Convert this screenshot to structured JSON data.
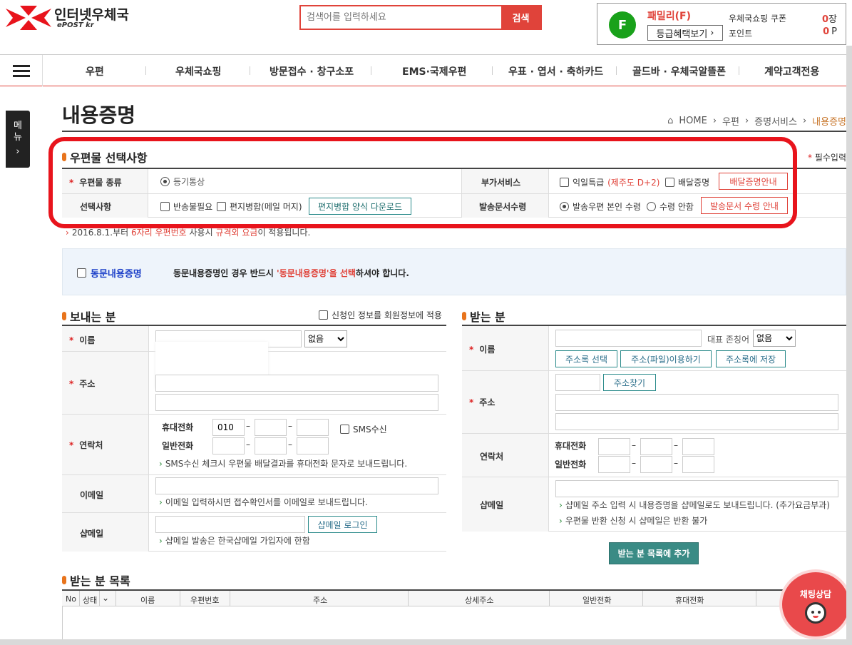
{
  "header": {
    "logo_title": "인터넷우체국",
    "logo_sub": "ePOST kr",
    "search_placeholder": "검색어를 입력하세요",
    "search_button": "검색",
    "member_initial": "F",
    "member_grade": "패밀리(F)",
    "grade_button": "등급혜택보기",
    "coupon_label": "우체국쇼핑 쿠폰",
    "coupon_value": "0",
    "coupon_unit": "장",
    "point_label": "포인트",
    "point_value": "0",
    "point_unit": "P"
  },
  "nav": {
    "items": [
      "우편",
      "우체국쇼핑",
      "방문접수 · 창구소포",
      "EMS·국제우편",
      "우표 · 엽서 · 축하카드",
      "골드바 · 우체국알뜰폰",
      "계약고객전용"
    ]
  },
  "side_menu": {
    "label1": "메",
    "label2": "뉴",
    "arrow": "›"
  },
  "page": {
    "title": "내용증명",
    "breadcrumb": [
      "HOME",
      "우편",
      "증명서비스",
      "내용증명"
    ],
    "required_note": "필수입력"
  },
  "mail_options": {
    "title": "우편물 선택사항",
    "type_label": "우편물 종류",
    "type_value": "등기통상",
    "extra_label": "부가서비스",
    "extra_next_day": "익일특급",
    "extra_next_day_note": "(제주도 D+2)",
    "extra_delivery_proof": "배달증명",
    "delivery_proof_guide": "배달증명안내",
    "select_label": "선택사항",
    "no_return": "반송불필요",
    "letter_merge": "편지병합(메일 머지)",
    "merge_download": "편지병합 양식 다운로드",
    "doc_receive_label": "발송문서수령",
    "receive_self": "발송우편 본인 수령",
    "receive_none": "수령 안함",
    "receive_guide": "발송문서 수령 안내",
    "notice_prefix": "2016.8.1.부터 ",
    "notice_red1": "6자리 우편번호",
    "notice_mid": " 사용시 ",
    "notice_red2": "규격외 요금",
    "notice_suffix": "이 적용됩니다."
  },
  "same_content": {
    "checkbox_label": "동문내용증명",
    "message_prefix": "동문내용증명인 경우 반드시 ",
    "message_red": "'동문내용증명'을 선택",
    "message_suffix": "하셔야 합니다."
  },
  "sender": {
    "title": "보내는 분",
    "apply_member": "신청인 정보를 회원정보에 적용",
    "name_label": "이름",
    "name_select": "없음",
    "address_label": "주소",
    "contact_label": "연락처",
    "mobile_label": "휴대전화",
    "mobile_first": "010",
    "phone_label": "일반전화",
    "sms_label": "SMS수신",
    "sms_note": "SMS수신 체크시 우편물 배달결과를 휴대전화 문자로 보내드립니다.",
    "email_label": "이메일",
    "email_note": "이메일 입력하시면 접수확인서를 이메일로 보내드립니다.",
    "shapmail_label": "샵메일",
    "shapmail_login": "샵메일 로그인",
    "shapmail_note": "샵메일 발송은 한국샵메일 가입자에 한함"
  },
  "receiver": {
    "title": "받는 분",
    "name_label": "이름",
    "rep_label": "대표 존칭어",
    "rep_select": "없음",
    "addr_book_select": "주소록 선택",
    "addr_file": "주소(파일)이용하기",
    "addr_book_save": "주소록에 저장",
    "address_label": "주소",
    "addr_search": "주소찾기",
    "contact_label": "연락처",
    "mobile_label": "휴대전화",
    "phone_label": "일반전화",
    "shapmail_label": "샵메일",
    "shapmail_note1": "샵메일 주소 입력 시 내용증명을 샵메일로도 보내드립니다. (추가요금부과)",
    "shapmail_note2": "우편물 반환 신청 시 샵메일은 반환 불가",
    "add_button": "받는 분 목록에 추가"
  },
  "receiver_list": {
    "title": "받는 분 목록",
    "columns": [
      "No",
      "상태",
      "",
      "이름",
      "우편번호",
      "주소",
      "상세주소",
      "일반전화",
      "휴대전화"
    ]
  },
  "chat": {
    "label": "채팅상담"
  },
  "colors": {
    "accent_red": "#e0433a",
    "teal": "#2a8a8a",
    "highlight_border": "#e8141c"
  }
}
